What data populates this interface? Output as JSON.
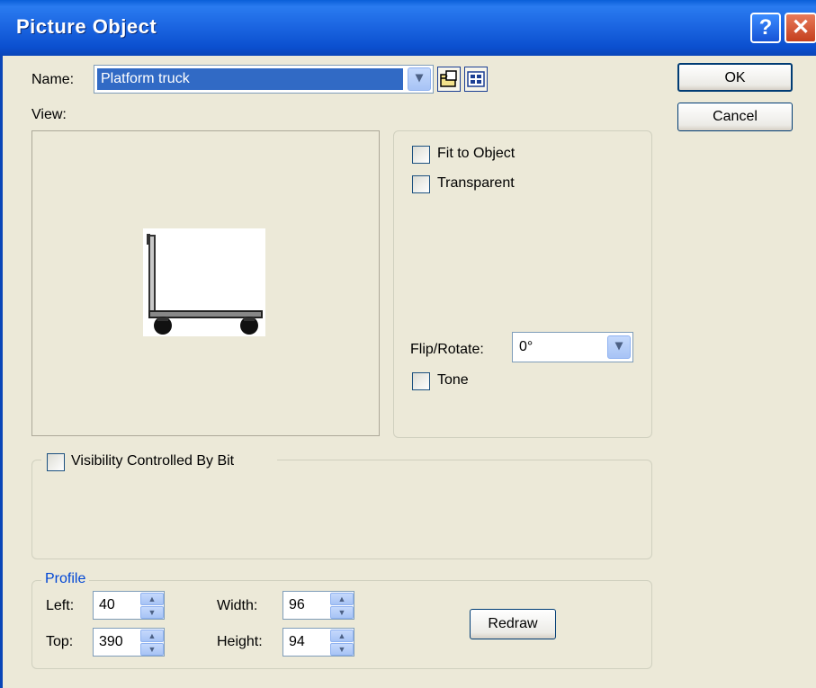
{
  "window": {
    "title": "Picture Object",
    "help_label": "?",
    "close_label": "✕"
  },
  "name_label": "Name:",
  "name_value": "Platform truck",
  "view_label": "View:",
  "buttons": {
    "ok": "OK",
    "cancel": "Cancel",
    "redraw": "Redraw"
  },
  "options": {
    "fit_to_object": "Fit to Object",
    "transparent": "Transparent",
    "flip_rotate_label": "Flip/Rotate:",
    "flip_rotate_value": "0°",
    "tone": "Tone"
  },
  "visibility": {
    "label": "Visibility Controlled By Bit"
  },
  "profile": {
    "title": "Profile",
    "left_label": "Left:",
    "left_value": "40",
    "top_label": "Top:",
    "top_value": "390",
    "width_label": "Width:",
    "width_value": "96",
    "height_label": "Height:",
    "height_value": "94"
  },
  "colors": {
    "titlebar": "#0b4fcf",
    "selection": "#316ac5",
    "profile_title": "#0046d5"
  },
  "icons": [
    "help-icon",
    "close-icon",
    "dropdown-arrow-icon",
    "open-folder-icon",
    "browse-grid-icon",
    "spin-up-icon",
    "spin-down-icon",
    "platform-truck-image"
  ]
}
